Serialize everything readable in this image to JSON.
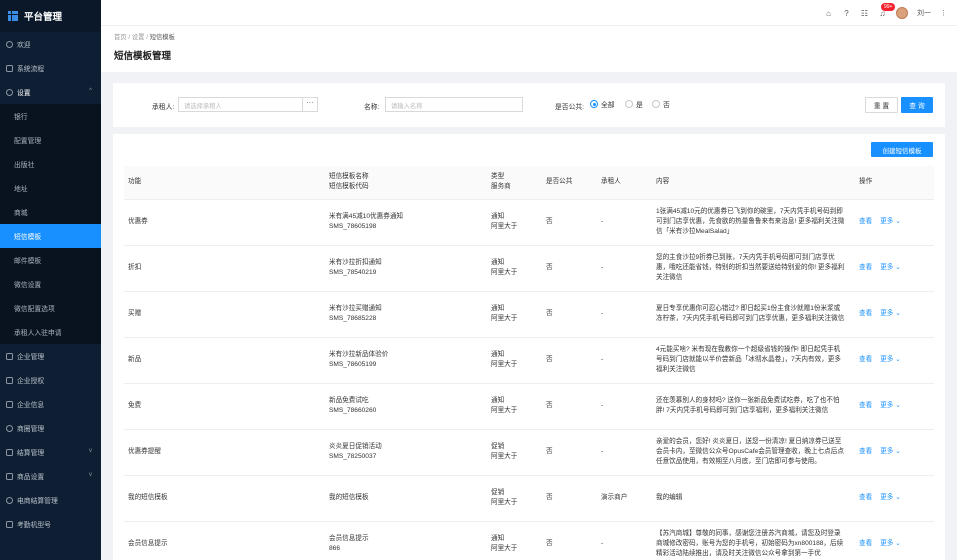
{
  "app": {
    "title": "平台管理"
  },
  "sidebar": {
    "items_top": [
      {
        "label": "欢迎",
        "icon": "circle-icon"
      },
      {
        "label": "系统流程",
        "icon": "monitor-icon"
      },
      {
        "label": "设置",
        "icon": "gear-icon",
        "caret": "^"
      }
    ],
    "sub_items": [
      {
        "label": "银行"
      },
      {
        "label": "配置管理"
      },
      {
        "label": "出版社"
      },
      {
        "label": "地址"
      },
      {
        "label": "商城"
      },
      {
        "label": "短信模板",
        "active": true
      },
      {
        "label": "邮件模板"
      },
      {
        "label": "微信设置"
      },
      {
        "label": "微信配置选项"
      },
      {
        "label": "承租人入驻申请"
      }
    ],
    "items_bottom": [
      {
        "label": "企业管理",
        "icon": "monitor-icon"
      },
      {
        "label": "企业授权",
        "icon": "monitor-icon"
      },
      {
        "label": "企业信息",
        "icon": "monitor-icon"
      },
      {
        "label": "商圈管理",
        "icon": "compass-icon"
      },
      {
        "label": "结算管理",
        "icon": "grid-icon",
        "caret": "v"
      },
      {
        "label": "商品设置",
        "icon": "grid-icon",
        "caret": "v"
      },
      {
        "label": "电商结算管理",
        "icon": "circle-icon"
      },
      {
        "label": "考勤机型号",
        "icon": "grid-icon"
      }
    ]
  },
  "header": {
    "badge": "99+",
    "user": "刘一",
    "more": "⋮"
  },
  "breadcrumb": {
    "home": "首页",
    "sep": "/",
    "parent": "设置",
    "current": "短信模板"
  },
  "page_title": "短信模板管理",
  "filter": {
    "tenant_label": "承租人:",
    "tenant_placeholder": "请选择承租人",
    "dots": "···",
    "name_label": "名称:",
    "name_placeholder": "请输入名称",
    "public_label": "是否公共:",
    "options": [
      "全部",
      "是",
      "否"
    ],
    "reset": "重 置",
    "search": "查 询"
  },
  "table": {
    "create_label": "创建短信模板",
    "headers": {
      "func": "功能",
      "name1": "短信模板名称",
      "name2": "短信模板代码",
      "type1": "类型",
      "type2": "服务商",
      "public": "是否公共",
      "tenant": "承租人",
      "content": "内容",
      "ops": "操作"
    },
    "view": "查看",
    "more": "更多 ⌄",
    "rows": [
      {
        "func": "优惠券",
        "name": "米有满45减10优惠券通知",
        "code": "SMS_78605198",
        "type": "通知",
        "provider": "阿里大于",
        "public": "否",
        "tenant": "-",
        "content": "1张满45减10元的优惠券已飞到你的碗里，7天内凭手机号码到即可到门店享优惠，先食欲的热量鲁鲁来有来治息! 更多福利关注微信「米有沙拉MealSalad」"
      },
      {
        "func": "折扣",
        "name": "米有沙拉折扣通知",
        "code": "SMS_78540219",
        "type": "通知",
        "provider": "阿里大于",
        "public": "否",
        "tenant": "-",
        "content": "您的主食沙拉9折券已到账，7天内凭手机号码即可到门店享优惠，哦吃还能省钱，特别的折扣当然要送给特别爱的你! 更多福利关注微信"
      },
      {
        "func": "买赠",
        "name": "米有沙拉买赠通知",
        "code": "SMS_78685228",
        "type": "通知",
        "provider": "阿里大于",
        "public": "否",
        "tenant": "-",
        "content": "夏日专享优惠你可忍心错过? 即日起买1份主食沙就赠1份米浆或冻柠茶，7天内凭手机号码即可到门店享优惠，更多福利关注微信"
      },
      {
        "func": "新品",
        "name": "米有沙拉新品体验价",
        "code": "SMS_78605199",
        "type": "通知",
        "provider": "阿里大于",
        "public": "否",
        "tenant": "-",
        "content": "4元能买啥? 米有现在我教你一个超级省钱的操作! 即日起凭手机号码到门店就能以半价尝新品「冰彻水晶卷」，7天内有效，更多福利关注微信"
      },
      {
        "func": "免费",
        "name": "新品免费试吃",
        "code": "SMS_78660260",
        "type": "通知",
        "provider": "阿里大于",
        "public": "否",
        "tenant": "-",
        "content": "还在羡慕别人的身材吗? 送你一张新品免费试吃券，吃了也不怕胖! 7天内凭手机号码即可到门店享福利，更多福利关注微信"
      },
      {
        "func": "优惠券提醒",
        "name": "炎炎夏日促销活动",
        "code": "SMS_78250037",
        "type": "促销",
        "provider": "阿里大于",
        "public": "否",
        "tenant": "-",
        "content": "亲爱的会员，您好! 炎炎夏日，送您一份清凉! 夏日纳凉券已送至会员卡内，至微信公众号OpusCafe会员管理查收，晚上七点后点任意饮品使用，有效期至八月底，至门店即可参与使用。"
      },
      {
        "func": "我的短信模板",
        "name": "我的短信模板",
        "code": "",
        "type": "促销",
        "provider": "阿里大于",
        "public": "否",
        "tenant": "演示商户",
        "content": "我的编辑"
      },
      {
        "func": "会员信息提示",
        "name": "会员信息提示",
        "code": "866",
        "type": "通知",
        "provider": "阿里大于",
        "public": "否",
        "tenant": "-",
        "content": "【苏汽商城】尊敬的同事，感谢您注册苏汽商城，请您及时登录商城修改密码，账号为您的手机号，初始密码为xn800188，后续精彩活动陆续推出，请及时关注微信公众号拿到第一手优"
      }
    ]
  }
}
